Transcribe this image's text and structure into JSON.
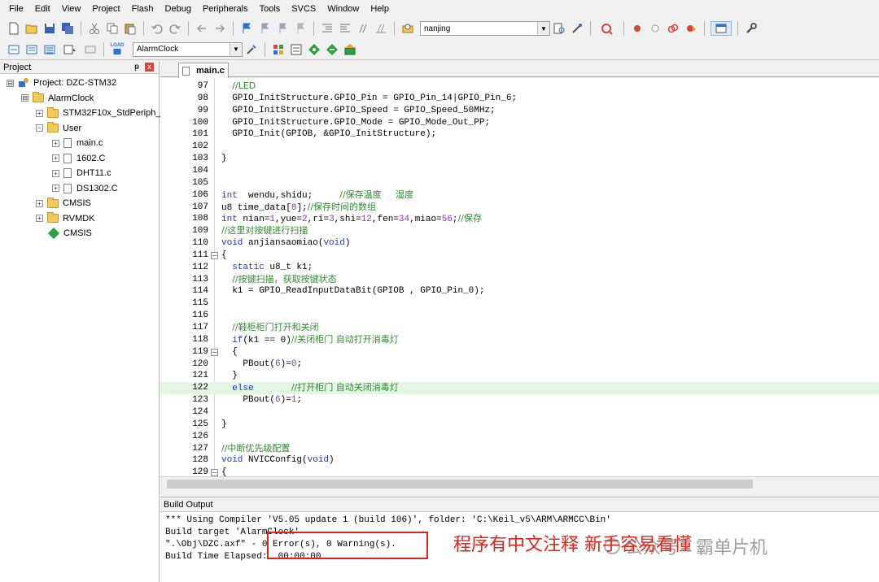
{
  "menu": [
    "File",
    "Edit",
    "View",
    "Project",
    "Flash",
    "Debug",
    "Peripherals",
    "Tools",
    "SVCS",
    "Window",
    "Help"
  ],
  "toolbar": {
    "find_combo_value": "nanjing",
    "target_combo_value": "AlarmClock",
    "load_label": "LOAD"
  },
  "project_panel": {
    "title": "Project",
    "pin_glyph": "ᵽ",
    "close_glyph": "x",
    "tree": [
      {
        "label": "Project: DZC-STM32",
        "level": 0,
        "type": "project",
        "expander": "⊟"
      },
      {
        "label": "AlarmClock",
        "level": 1,
        "type": "folder",
        "expander": "⊟"
      },
      {
        "label": "STM32F10x_StdPeriph_",
        "level": 2,
        "type": "folder",
        "expander": "+"
      },
      {
        "label": "User",
        "level": 2,
        "type": "folder",
        "expander": "−"
      },
      {
        "label": "main.c",
        "level": 3,
        "type": "file",
        "expander": "+"
      },
      {
        "label": "1602.C",
        "level": 3,
        "type": "file",
        "expander": "+"
      },
      {
        "label": "DHT11.c",
        "level": 3,
        "type": "file",
        "expander": "+"
      },
      {
        "label": "DS1302.C",
        "level": 3,
        "type": "file",
        "expander": "+"
      },
      {
        "label": "CMSIS",
        "level": 2,
        "type": "folder",
        "expander": "+"
      },
      {
        "label": "RVMDK",
        "level": 2,
        "type": "folder",
        "expander": "+"
      },
      {
        "label": "CMSIS",
        "level": 2,
        "type": "component",
        "expander": ""
      }
    ]
  },
  "editor": {
    "tab_label": "main.c",
    "highlight_line": "122",
    "lines": [
      {
        "n": "97",
        "code": "  //LED",
        "fold": ""
      },
      {
        "n": "98",
        "code": "  GPIO_InitStructure.GPIO_Pin = GPIO_Pin_14|GPIO_Pin_6;",
        "fold": ""
      },
      {
        "n": "99",
        "code": "  GPIO_InitStructure.GPIO_Speed = GPIO_Speed_50MHz;",
        "fold": ""
      },
      {
        "n": "100",
        "code": "  GPIO_InitStructure.GPIO_Mode = GPIO_Mode_Out_PP;",
        "fold": ""
      },
      {
        "n": "101",
        "code": "  GPIO_Init(GPIOB, &GPIO_InitStructure);",
        "fold": ""
      },
      {
        "n": "102",
        "code": "",
        "fold": ""
      },
      {
        "n": "103",
        "code": "}",
        "fold": ""
      },
      {
        "n": "104",
        "code": "",
        "fold": ""
      },
      {
        "n": "105",
        "code": "",
        "fold": ""
      },
      {
        "n": "106",
        "code": "int  wendu,shidu;     //保存温度     湿度",
        "fold": ""
      },
      {
        "n": "107",
        "code": "u8 time_data[8];//保存时间的数组",
        "fold": ""
      },
      {
        "n": "108",
        "code": "int nian=1,yue=2,ri=3,shi=12,fen=34,miao=56;//保存",
        "fold": ""
      },
      {
        "n": "109",
        "code": "//这里对按键进行扫描",
        "fold": ""
      },
      {
        "n": "110",
        "code": "void anjiansaomiao(void)",
        "fold": ""
      },
      {
        "n": "111",
        "code": "{",
        "fold": "−"
      },
      {
        "n": "112",
        "code": "  static u8_t k1;",
        "fold": ""
      },
      {
        "n": "113",
        "code": "  //按键扫描，获取按键状态",
        "fold": ""
      },
      {
        "n": "114",
        "code": "  k1 = GPIO_ReadInputDataBit(GPIOB , GPIO_Pin_0);",
        "fold": ""
      },
      {
        "n": "115",
        "code": "",
        "fold": ""
      },
      {
        "n": "116",
        "code": "",
        "fold": ""
      },
      {
        "n": "117",
        "code": "  //鞋柜柜门打开和关闭",
        "fold": ""
      },
      {
        "n": "118",
        "code": "  if(k1 == 0)//关闭柜门 自动打开消毒灯",
        "fold": ""
      },
      {
        "n": "119",
        "code": "  {",
        "fold": "−"
      },
      {
        "n": "120",
        "code": "    PBout(6)=0;",
        "fold": ""
      },
      {
        "n": "121",
        "code": "  }",
        "fold": ""
      },
      {
        "n": "122",
        "code": "  else       //打开柜门 自动关闭消毒灯",
        "fold": ""
      },
      {
        "n": "123",
        "code": "    PBout(6)=1;",
        "fold": ""
      },
      {
        "n": "124",
        "code": "",
        "fold": ""
      },
      {
        "n": "125",
        "code": "}",
        "fold": ""
      },
      {
        "n": "126",
        "code": "",
        "fold": ""
      },
      {
        "n": "127",
        "code": "//中断优先级配置",
        "fold": ""
      },
      {
        "n": "128",
        "code": "void NVICConfig(void)",
        "fold": ""
      },
      {
        "n": "129",
        "code": "{",
        "fold": "−"
      }
    ]
  },
  "build_output": {
    "title": "Build Output",
    "lines": [
      "*** Using Compiler 'V5.05 update 1 (build 106)', folder: 'C:\\Keil_v5\\ARM\\ARMCC\\Bin'",
      "Build target 'AlarmClock'",
      "\".\\Obj\\DZC.axf\" - 0 Error(s), 0 Warning(s).",
      "Build Time Elapsed:  00:00:00"
    ],
    "annotation": "程序有中文注释 新手容易看懂",
    "watermark": "公众号 · 霸单片机"
  },
  "colors": {
    "keyword": "#1a37d8",
    "comment": "#2e8b2e",
    "number": "#8a2be2",
    "annotation": "#e0241b",
    "highlight": "#e3f5e3"
  }
}
